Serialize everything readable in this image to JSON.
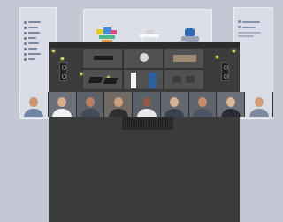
{
  "colors": {
    "backdrop": "#c3c8d4",
    "control_window": "#3a3a3a",
    "status_indicator": "#d8e64a"
  },
  "left_sidebar": {
    "title": "",
    "items": [
      {
        "icon": "dot-icon"
      },
      {
        "icon": "dot-icon"
      },
      {
        "icon": "dot-icon"
      },
      {
        "icon": "dot-icon"
      },
      {
        "icon": "dot-icon"
      },
      {
        "icon": "dot-icon"
      },
      {
        "icon": "dot-icon"
      },
      {
        "icon": "dot-icon"
      }
    ]
  },
  "center_window": {
    "title": "",
    "previews": [
      "colorful-workspace-preview",
      "white-desk-preview",
      "pod-chairs-preview"
    ]
  },
  "right_panel": {
    "title": ""
  },
  "room_grid": {
    "cells": [
      "speaker-bar-icon",
      "ceiling-speaker-icon",
      "conference-table-icon",
      "tablet-device-icon",
      "floor-speaker-icon",
      "lounge-chairs-icon"
    ]
  },
  "participants": [
    {
      "name": "participant-1",
      "tone": "light"
    },
    {
      "name": "participant-2",
      "tone": "dark"
    },
    {
      "name": "participant-3",
      "tone": "dark"
    },
    {
      "name": "participant-4",
      "tone": "dark"
    },
    {
      "name": "participant-5",
      "tone": "dark"
    },
    {
      "name": "participant-6",
      "tone": "dark"
    },
    {
      "name": "participant-7",
      "tone": "dark"
    },
    {
      "name": "participant-8",
      "tone": "dark"
    },
    {
      "name": "participant-9",
      "tone": "light"
    }
  ]
}
